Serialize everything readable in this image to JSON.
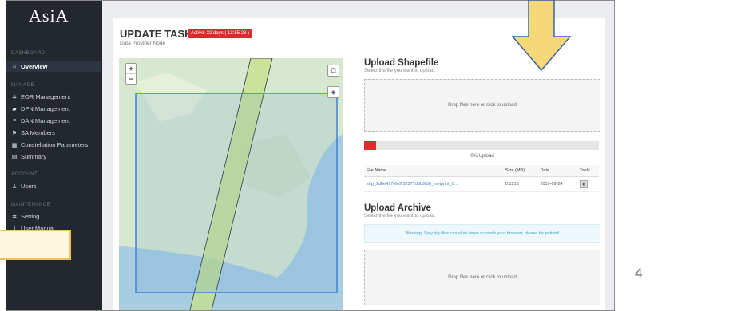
{
  "sidebar": {
    "logo": "AsiA",
    "sections": [
      {
        "label": "DASHBOARD",
        "items": [
          {
            "label": "Overview",
            "icon": "home-icon",
            "active": true
          }
        ]
      },
      {
        "label": "MANAGE",
        "items": [
          {
            "label": "EOR Management",
            "icon": "gear-icon"
          },
          {
            "label": "DPN Management",
            "icon": "folder-icon"
          },
          {
            "label": "DAN Management",
            "icon": "list-icon"
          },
          {
            "label": "SA Members",
            "icon": "flag-icon"
          },
          {
            "label": "Constellation Parameters",
            "icon": "grid-icon"
          },
          {
            "label": "Summary",
            "icon": "document-icon"
          }
        ]
      },
      {
        "label": "ACCOUNT",
        "items": [
          {
            "label": "Users",
            "icon": "user-icon"
          }
        ]
      },
      {
        "label": "MAINTENANCE",
        "items": [
          {
            "label": "Setting",
            "icon": "gear-icon"
          },
          {
            "label": "User Manual",
            "icon": "info-icon"
          }
        ]
      }
    ]
  },
  "header": {
    "title": "UPDATE TASKS",
    "badge": "Active: 32 days ( 13:55:28 )",
    "subtitle": "Data Provider Node"
  },
  "map": {
    "zoom_in": "+",
    "zoom_out": "−"
  },
  "upload_shapefile": {
    "title": "Upload Shapefile",
    "subtitle": "Select the file you want to upload.",
    "dropzone": "Drop files here or click to upload",
    "progress_label": "0% Upload",
    "progress_percent": 5,
    "table": {
      "headers": [
        "File Name",
        "Size (MB)",
        "Date",
        "Tools"
      ],
      "rows": [
        {
          "name": "shp_1d8e4976fe9f32277d3b9f58_footprint_0...",
          "size": "0.1213",
          "date": "2019-09-24"
        }
      ]
    }
  },
  "upload_archive": {
    "title": "Upload Archive",
    "subtitle": "Select the file you want to upload.",
    "warning": "Warning! Very big files can slow down or crash your browser, please be patient!",
    "dropzone": "Drop files here or click to upload"
  },
  "slide_number": "4",
  "colors": {
    "sidebar": "#23272e",
    "badge": "#d82c2c",
    "arrow": "#f7d879",
    "footprint": "#c6e08a",
    "aoi": "#3c82d8"
  }
}
